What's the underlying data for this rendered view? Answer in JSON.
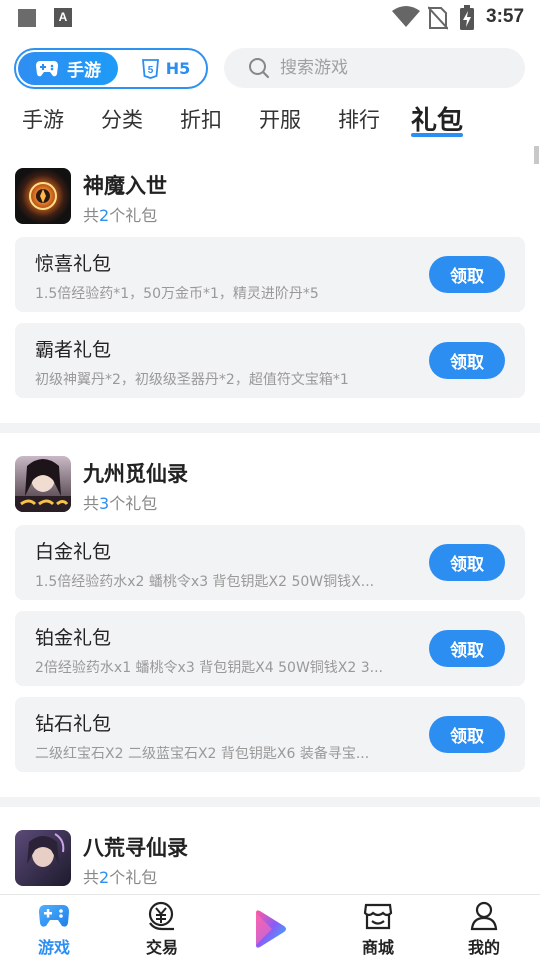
{
  "status_bar": {
    "time": "3:57",
    "app_icon_letter": "A"
  },
  "mode_toggle": {
    "active_label": "手游",
    "inactive_label": "H5",
    "h5_badge": "5"
  },
  "search": {
    "placeholder": "搜索游戏"
  },
  "category_tabs": [
    {
      "label": "手游"
    },
    {
      "label": "分类"
    },
    {
      "label": "折扣"
    },
    {
      "label": "开服"
    },
    {
      "label": "排行"
    },
    {
      "label": "礼包",
      "active": true
    }
  ],
  "claim_label": "领取",
  "games": [
    {
      "name": "神魔入世",
      "count_prefix": "共",
      "count": "2",
      "count_suffix": "个礼包",
      "gifts": [
        {
          "title": "惊喜礼包",
          "desc": "1.5倍经验药*1，50万金币*1，精灵进阶丹*5"
        },
        {
          "title": "霸者礼包",
          "desc": "初级神翼丹*2，初级级圣器丹*2，超值符文宝箱*1"
        }
      ]
    },
    {
      "name": "九州觅仙录",
      "count_prefix": "共",
      "count": "3",
      "count_suffix": "个礼包",
      "gifts": [
        {
          "title": "白金礼包",
          "desc": "1.5倍经验药水x2  蟠桃令x3   背包钥匙X2  50W铜钱X..."
        },
        {
          "title": "铂金礼包",
          "desc": "2倍经验药水x1  蟠桃令x3 背包钥匙X4  50W铜钱X2 3..."
        },
        {
          "title": "钻石礼包",
          "desc": "二级红宝石X2  二级蓝宝石X2  背包钥匙X6  装备寻宝..."
        }
      ]
    },
    {
      "name": "八荒寻仙录",
      "count_prefix": "共",
      "count": "2",
      "count_suffix": "个礼包",
      "gifts": []
    }
  ],
  "bottom_nav": [
    {
      "label": "游戏",
      "icon": "gamepad-icon",
      "active": true
    },
    {
      "label": "交易",
      "icon": "trade-icon"
    },
    {
      "label": "",
      "icon": "play-logo-icon"
    },
    {
      "label": "商城",
      "icon": "store-icon"
    },
    {
      "label": "我的",
      "icon": "profile-icon"
    }
  ],
  "colors": {
    "accent": "#2d8ef2",
    "card_bg": "#f2f3f5",
    "separator": "#f2f3f5"
  }
}
